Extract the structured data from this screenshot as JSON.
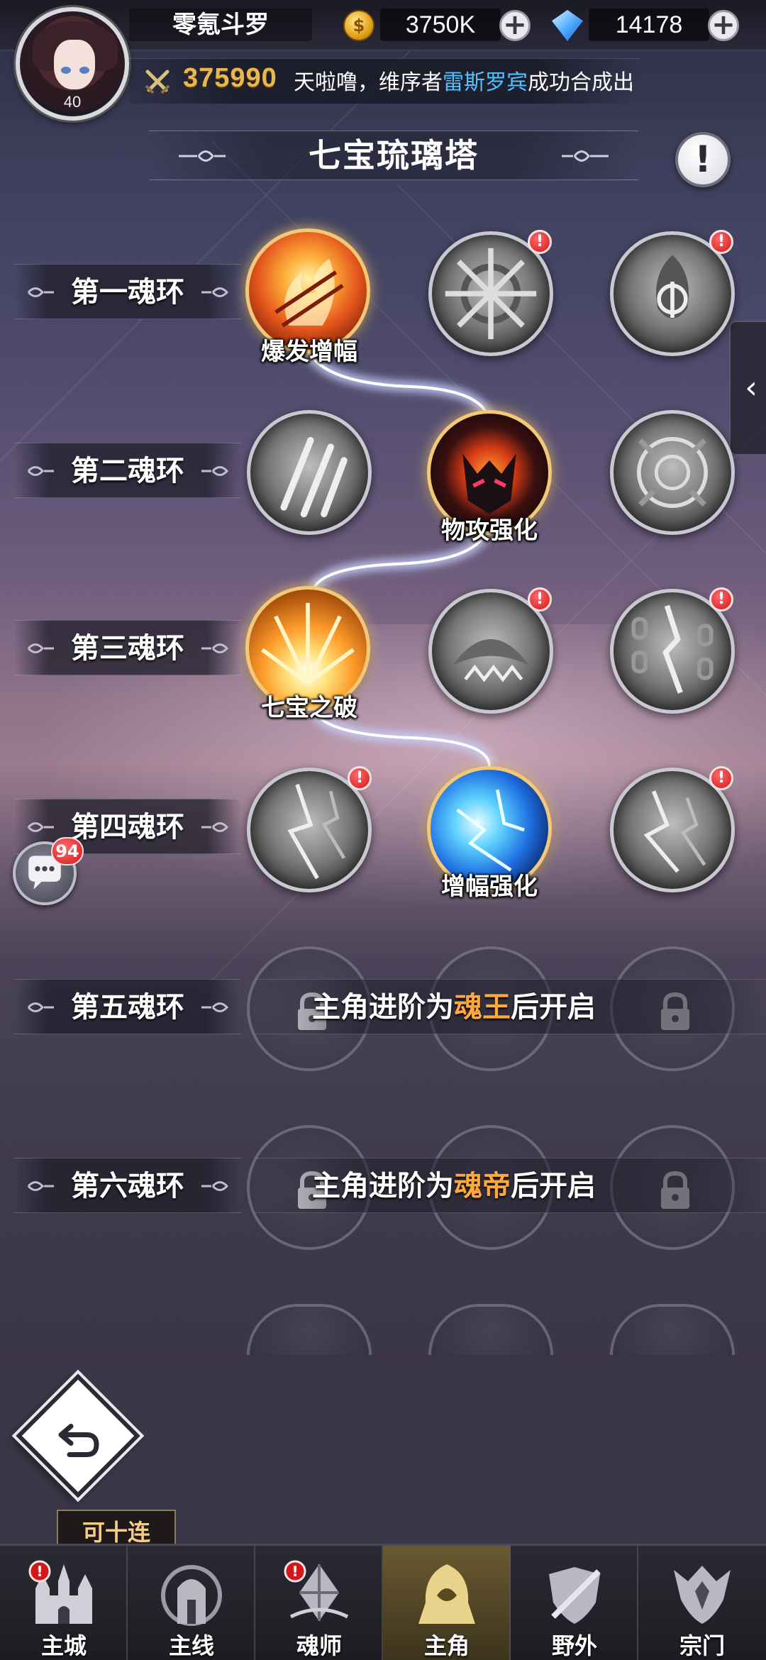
{
  "player": {
    "level": "40",
    "name": "零氪斗罗",
    "gold": "3750K",
    "gems": "14178",
    "power": "375990"
  },
  "ticker": {
    "prefix": "天啦噜，维序者",
    "highlight": "雷斯罗宾",
    "suffix": "成功合成出"
  },
  "page": {
    "title": "七宝琉璃塔",
    "info_icon": "!",
    "side_tab_icon": "‹"
  },
  "rings": [
    {
      "label": "第一魂环",
      "skills": [
        {
          "name": "爆发增幅",
          "state": "active",
          "art": "fire",
          "alert": false
        },
        {
          "name": "",
          "state": "inactive",
          "art": "wheel",
          "alert": true
        },
        {
          "name": "",
          "state": "inactive",
          "art": "flame-crest",
          "alert": true
        }
      ]
    },
    {
      "label": "第二魂环",
      "skills": [
        {
          "name": "",
          "state": "inactive",
          "art": "claws",
          "alert": false
        },
        {
          "name": "物攻强化",
          "state": "active",
          "art": "demon",
          "alert": false
        },
        {
          "name": "",
          "state": "inactive",
          "art": "mandala",
          "alert": false
        }
      ]
    },
    {
      "label": "第三魂环",
      "skills": [
        {
          "name": "七宝之破",
          "state": "active",
          "art": "blast",
          "alert": false
        },
        {
          "name": "",
          "state": "inactive",
          "art": "maw",
          "alert": true
        },
        {
          "name": "",
          "state": "inactive",
          "art": "chains",
          "alert": true
        }
      ]
    },
    {
      "label": "第四魂环",
      "skills": [
        {
          "name": "",
          "state": "inactive",
          "art": "lightning",
          "alert": true
        },
        {
          "name": "增幅强化",
          "state": "active",
          "art": "electric",
          "alert": false
        },
        {
          "name": "",
          "state": "inactive",
          "art": "lightning",
          "alert": true
        }
      ]
    }
  ],
  "locked_rings": [
    {
      "label": "第五魂环",
      "msg_prefix": "主角进阶为",
      "rank": "魂王",
      "msg_suffix": "后开启"
    },
    {
      "label": "第六魂环",
      "msg_prefix": "主角进阶为",
      "rank": "魂帝",
      "msg_suffix": "后开启"
    }
  ],
  "chat": {
    "badge": "94"
  },
  "tooltip": "可十连",
  "nav": [
    {
      "label": "主城",
      "icon": "castle-icon",
      "alert": true
    },
    {
      "label": "主线",
      "icon": "gate-icon",
      "alert": false
    },
    {
      "label": "魂师",
      "icon": "crystal-icon",
      "alert": true
    },
    {
      "label": "主角",
      "icon": "hooded-figure-icon",
      "alert": false,
      "active": true
    },
    {
      "label": "野外",
      "icon": "shield-sword-icon",
      "alert": false
    },
    {
      "label": "宗门",
      "icon": "crest-icon",
      "alert": false
    }
  ],
  "colors": {
    "accent_gold": "#e9b84a",
    "highlight_blue": "#4ec3ff",
    "rank_orange": "#ffa93a",
    "alert_red": "#d4161a"
  }
}
